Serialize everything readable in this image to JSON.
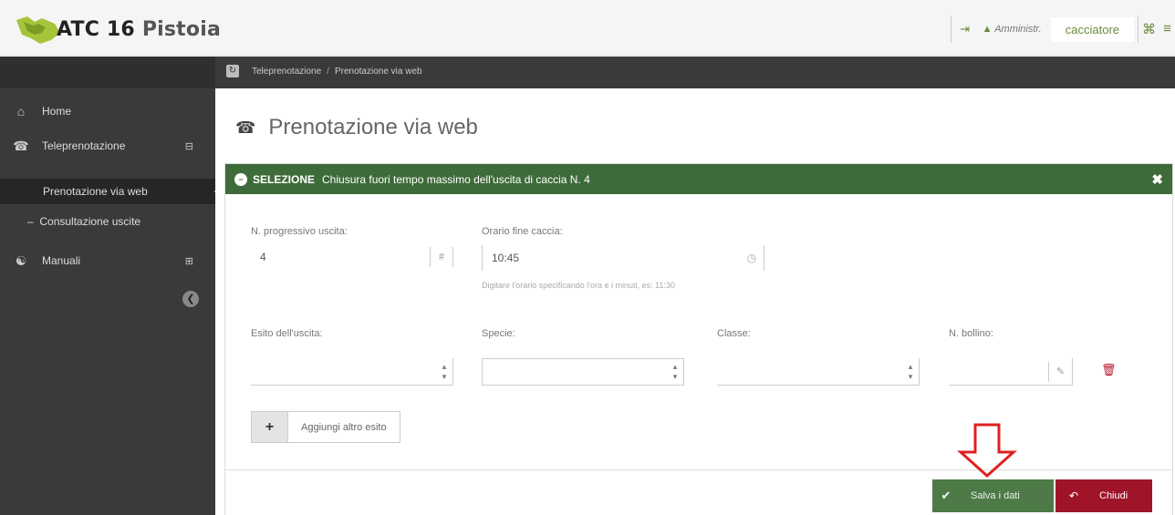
{
  "header": {
    "brand": "ATC 16",
    "brand_sub": "Pistoia",
    "user_label": "Amministr.",
    "username": "cacciatore",
    "logout_icon": "logout-icon",
    "tools_icon": "tools-icon"
  },
  "breadcrumb": {
    "items": [
      "Teleprenotazione",
      "Prenotazione via web"
    ]
  },
  "sidebar": {
    "items": [
      {
        "label": "Home",
        "icon": "home-icon"
      },
      {
        "label": "Teleprenotazione",
        "icon": "phone-icon"
      },
      {
        "label": "Prenotazione via web"
      },
      {
        "label": "Consultazione uscite"
      },
      {
        "label": "Manuali",
        "icon": "manual-icon"
      }
    ]
  },
  "page": {
    "title": "Prenotazione via web"
  },
  "panel": {
    "selection_label": "SELEZIONE",
    "heading": "Chiusura fuori tempo massimo dell'uscita di caccia N. 4",
    "fields": {
      "uscita_label": "N. progressivo uscita:",
      "uscita_value": "4",
      "ora_label": "Orario fine caccia:",
      "ora_value": "10:45",
      "ora_help": "Digitare l'orario specificando l'ora e i minuti, es: 11:30",
      "esito_label": "Esito dell'uscita:",
      "specie_label": "Specie:",
      "classe_label": "Classe:",
      "bollino_label": "N. bollino:"
    },
    "add_button": "Aggiungi altro esito",
    "save_button": "Salva i dati",
    "close_button": "Chiudi"
  },
  "colors": {
    "panel_header": "#3e6b3a",
    "save": "#4d7a47",
    "close": "#a0142a",
    "annotation_arrow": "#e02020"
  }
}
